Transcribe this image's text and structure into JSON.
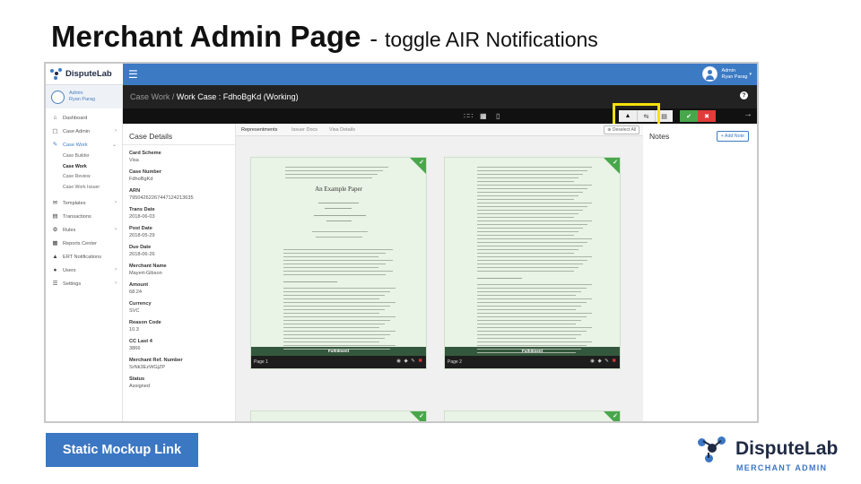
{
  "slide": {
    "title": "Merchant Admin Page",
    "dash": "-",
    "subtitle": "toggle AIR Notifications",
    "mockup_button": "Static Mockup Link",
    "footer_brand": "DisputeLab",
    "footer_tagline": "MERCHANT ADMIN"
  },
  "app": {
    "brand": "DisputeLab",
    "menu_icon": "hamburger-icon",
    "user_role": "Admin",
    "user_name": "Ryan Parag",
    "sidebar": {
      "items": [
        {
          "label": "Dashboard",
          "icon": "home-icon"
        },
        {
          "label": "Case Admin",
          "icon": "briefcase-icon"
        },
        {
          "label": "Case Work",
          "icon": "edit-icon"
        },
        {
          "label": "Templates",
          "icon": "mail-icon"
        },
        {
          "label": "Transactions",
          "icon": "card-icon"
        },
        {
          "label": "Rules",
          "icon": "gear-icon"
        },
        {
          "label": "Reports Center",
          "icon": "document-icon"
        },
        {
          "label": "ERT Notifications",
          "icon": "warning-icon"
        },
        {
          "label": "Users",
          "icon": "users-icon"
        },
        {
          "label": "Settings",
          "icon": "sliders-icon"
        }
      ],
      "sub_items": [
        "Case Builder",
        "Case Work",
        "Case Review",
        "Case Work Issuer"
      ]
    },
    "breadcrumb": {
      "parent": "Case Work /",
      "current": "Work Case : FdhoBgKd (Working)"
    },
    "details": {
      "title": "Case Details",
      "fields": [
        {
          "label": "Card Scheme",
          "value": "Visa"
        },
        {
          "label": "Case Number",
          "value": "FdhoBgKd"
        },
        {
          "label": "ARN",
          "value": "79504262267447124213635"
        },
        {
          "label": "Trans Date",
          "value": "2018-06-03"
        },
        {
          "label": "Post Date",
          "value": "2018-05-29"
        },
        {
          "label": "Due Date",
          "value": "2018-06-26"
        },
        {
          "label": "Merchant Name",
          "value": "Mayert-Gibson"
        },
        {
          "label": "Amount",
          "value": "68.24"
        },
        {
          "label": "Currency",
          "value": "SVC"
        },
        {
          "label": "Reason Code",
          "value": "10.3"
        },
        {
          "label": "CC Last 4",
          "value": "3866"
        },
        {
          "label": "Merchant Ref. Number",
          "value": "SrNk3EzWGjZP"
        },
        {
          "label": "Status",
          "value": "Assigned"
        }
      ]
    },
    "tabs": [
      "Representments",
      "Issuer Docs",
      "Visa Details"
    ],
    "deselect_label": "Deselect All",
    "pages": [
      {
        "label": "Page 1",
        "title": "An Example Paper",
        "footer": "Fulfillment"
      },
      {
        "label": "Page 2",
        "title": "",
        "footer": "Fulfillment"
      }
    ],
    "notes": {
      "title": "Notes",
      "add_label": "+ Add Note"
    },
    "colors": {
      "topbar": "#3c7ac4",
      "accent_green": "#49a74b",
      "accent_red": "#e23b3b",
      "highlight": "#f6e20c"
    }
  }
}
